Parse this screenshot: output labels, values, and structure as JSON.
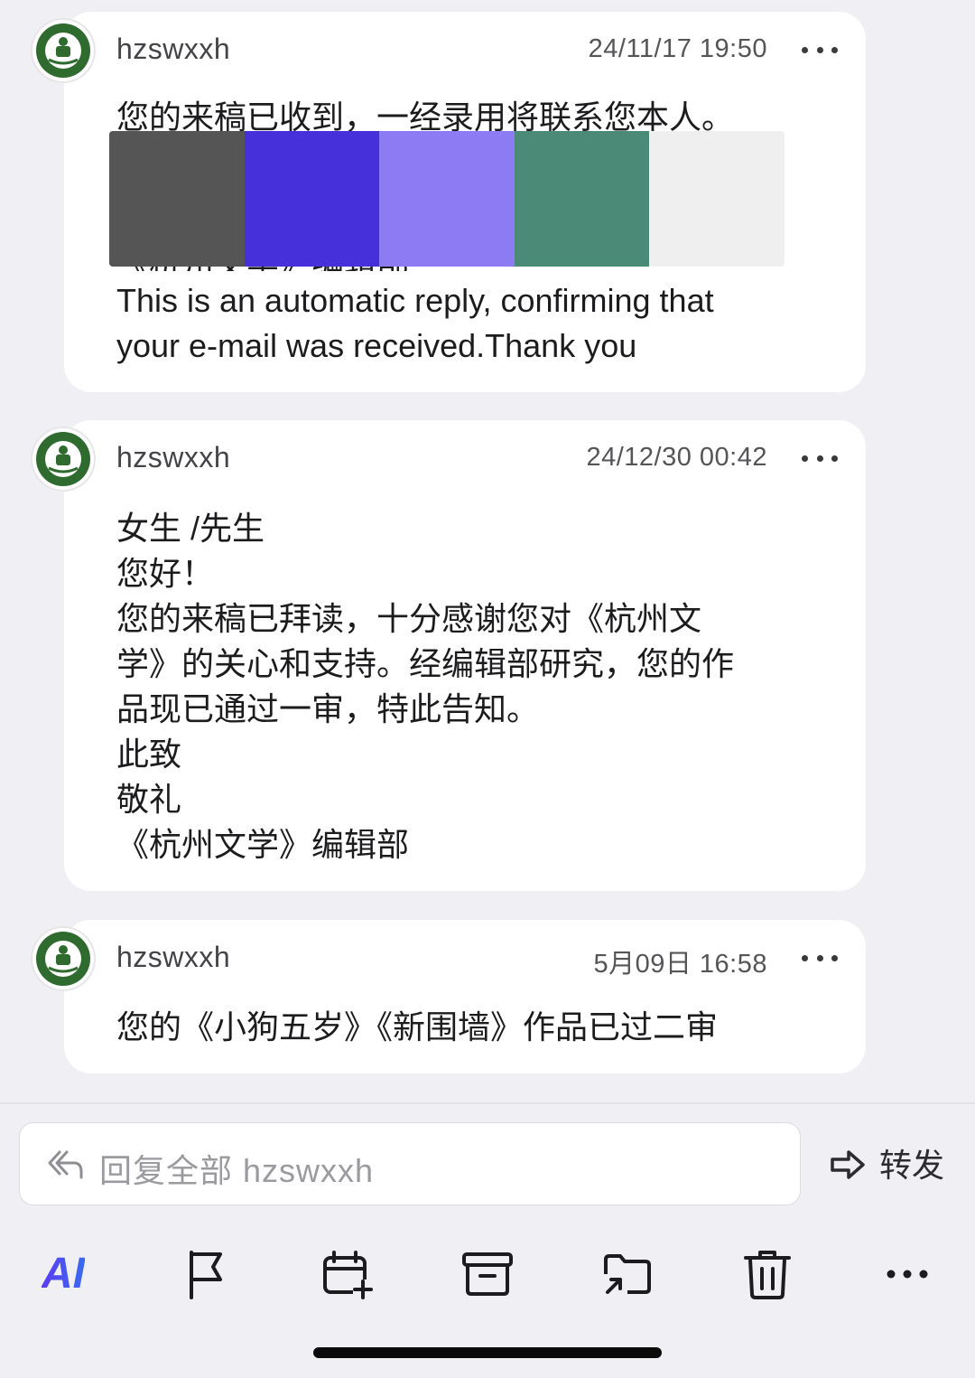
{
  "messages": [
    {
      "sender": "hzswxxh",
      "time": "24/11/17 19:50",
      "line1": "您的来稿已收到，一经录用将联系您本人。",
      "partial": "《杭州文学》编辑部",
      "english": "This is an automatic reply, confirming that\nyour e-mail was received.Thank you",
      "redaction_colors": [
        "#555555",
        "#4530d9",
        "#8c7bf2",
        "#4a8a76",
        "#efefef"
      ]
    },
    {
      "sender": "hzswxxh",
      "time": "24/12/30 00:42",
      "body": "女生 /先生\n您好！\n您的来稿已拜读，十分感谢您对《杭州文\n学》的关心和支持。经编辑部研究，您的作\n品现已通过一审，特此告知。\n此致\n敬礼\n《杭州文学》编辑部"
    },
    {
      "sender": "hzswxxh",
      "time": "5月09日 16:58",
      "body": "您的《小狗五岁》《新围墙》作品已过二审"
    }
  ],
  "reply": {
    "label": "回复全部  hzswxxh",
    "icon": "reply-all-icon"
  },
  "forward": {
    "label": "转发",
    "icon": "forward-arrow-icon"
  },
  "toolbar": {
    "ai_label": "AI",
    "icons": [
      "flag-icon",
      "calendar-add-icon",
      "archive-icon",
      "move-folder-icon",
      "trash-icon",
      "more-icon"
    ]
  },
  "colors": {
    "background": "#efeff4",
    "card": "#ffffff",
    "ai_gradient": [
      "#5b3cf5",
      "#3a6af0"
    ]
  }
}
